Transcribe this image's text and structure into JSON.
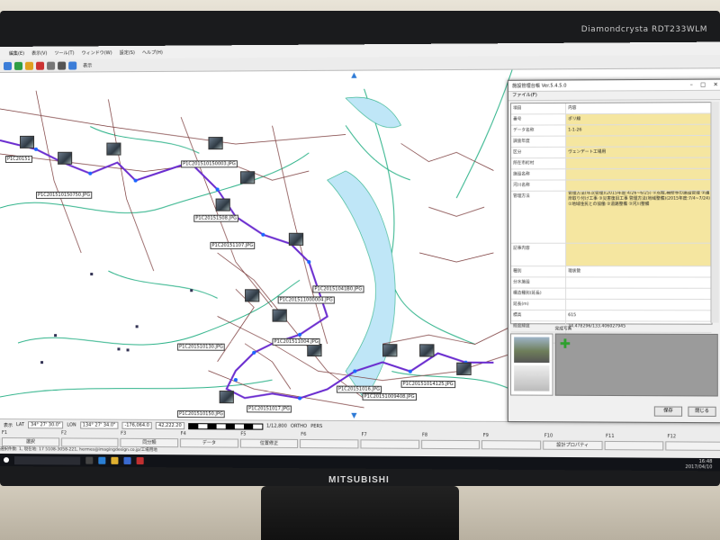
{
  "monitor": {
    "brand_label": "Diamondcrysta RDT233WLM",
    "maker": "MITSUBISHI"
  },
  "menu": [
    "編集(E)",
    "表示(V)",
    "ツール(T)",
    "ウィンドウ(W)",
    "設定(S)",
    "ヘルプ(H)"
  ],
  "toolbar": {
    "zoom_select": "表示"
  },
  "map": {
    "photo_labels": [
      "P1C20151",
      "P1C201510150750.JPG",
      "P1C201510150003.JPG",
      "P1C20151508.JPG",
      "P1C20151107.JPG",
      "P1C201511000004.JPG",
      "P1C20151041B0.JPG",
      "P1C201511004.JPG",
      "P1C201510130.JPG",
      "P1C20151014125.JPG",
      "P1C20151016.JPG",
      "P1C20151009408.JPG",
      "P1C201510150.JPG",
      "P1C20151017.JPG"
    ]
  },
  "status": {
    "mode": "表示",
    "lat_label": "LAT",
    "lat_value": "34° 27' 30.0\"",
    "lon_label": "LON",
    "lon_value": "134° 27' 34.0\"",
    "x_value": "-176,064.0",
    "y_value": "42,222.20",
    "scale": "1/12,800",
    "ortho": "ORTHO",
    "pers": "PERS"
  },
  "fkeys": [
    "F1",
    "F2",
    "F3",
    "F4",
    "F5",
    "F6",
    "F7",
    "F8",
    "F9",
    "F10",
    "F11",
    "F12"
  ],
  "fbuttons": [
    "選択",
    "",
    "同分類",
    "データ",
    "位置修正",
    "",
    "",
    "",
    "",
    "設計プロパティ",
    "",
    ""
  ],
  "infobar": "選択件数: 1,  現在地: 17                    5108-3058-221, hermes@imagingdesign.co.jp/工場用地",
  "taskbar": {
    "search_placeholder": "",
    "time": "16:48",
    "date": "2017/04/10"
  },
  "dialog": {
    "title": "施設管理台帳 Ver.5.4.5.0",
    "menu": "ファイル(F)",
    "rows": [
      {
        "key": "項目",
        "value": "内容",
        "hl": false
      },
      {
        "key": "番号",
        "value": "ポリ線",
        "hl": true
      },
      {
        "key": "データ名称",
        "value": "1-1-26",
        "hl": true
      },
      {
        "key": "調査年度",
        "value": "",
        "hl": true
      },
      {
        "key": "区分",
        "value": "ヴェンデート工場用",
        "hl": true
      },
      {
        "key": "所在市町村",
        "value": "",
        "hl": true
      },
      {
        "key": "施設名称",
        "value": "",
        "hl": true
      },
      {
        "key": "河川名称",
        "value": "",
        "hl": true
      },
      {
        "key": "管理方法",
        "value": "管理方法(年次管理)(2015年度:4/26~6/25) ①点検,補修等の施設管理 ②護岸取り付け工事 ③災害復旧工事 管理方法(地域整備)(2015年度:7/4~7/24) ①地域住民との協働 ②道路整備 ③河川整備",
        "hl": true,
        "tall": true
      },
      {
        "key": "記事内容",
        "value": "",
        "hl": true,
        "mid": true
      },
      {
        "key": "種別",
        "value": "現状管",
        "hl": false
      },
      {
        "key": "分水施設",
        "value": "",
        "hl": false
      },
      {
        "key": "構造種別(延長)",
        "value": "",
        "hl": false
      },
      {
        "key": "延長(m)",
        "value": "",
        "hl": false
      },
      {
        "key": "標高",
        "value": "615",
        "hl": false
      },
      {
        "key": "経度緯度",
        "value": "34.478296/133.406027945",
        "hl": false
      },
      {
        "key": "備考",
        "value": "",
        "hl": false
      }
    ],
    "photo_section_label": "関連写真",
    "completed_label": "完成写真",
    "ok_button": "保存",
    "close_button": "閉じる"
  },
  "colors": {
    "route": "#6a2ccf",
    "road": "#7a3a3a",
    "river": "#2fb38a",
    "highlight": "#f5e6a0"
  }
}
